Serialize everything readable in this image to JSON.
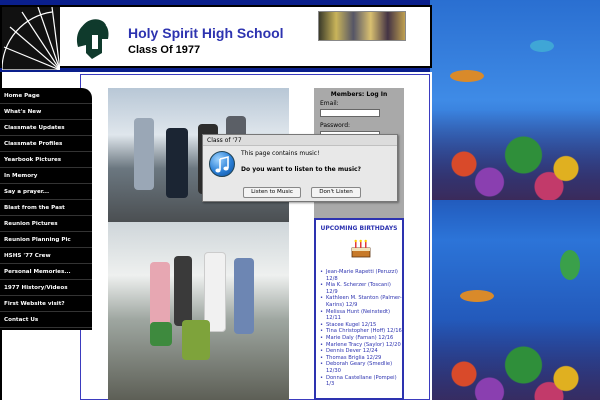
{
  "header": {
    "school_name": "Holy Spirit High School",
    "class_of": "Class Of 1977"
  },
  "nav": {
    "items": [
      "Home Page",
      "What's New",
      "Classmate Updates",
      "Classmate Profiles",
      "Yearbook Pictures",
      "In Memory",
      "Say a prayer...",
      "Blast from the Past",
      "Reunion Pictures",
      "Reunion Planning Pic",
      "HSHS '77 Crew",
      "Personal Memories...",
      "1977 History/Videos",
      "First Website visit?",
      "Contact Us"
    ]
  },
  "login": {
    "title": "Members: Log In",
    "email_label": "Email:",
    "password_label": "Password:"
  },
  "birthdays": {
    "title": "UPCOMING BIRTHDAYS",
    "entries": [
      "Jean-Marie Rapetti (Peruzzi)  12/8",
      "Mia K. Scherzer (Toscani)  12/9",
      "Kathleen M. Stanton (Palmer-Karins)  12/9",
      "Melissa Hunt (Neinstedt)  12/11",
      "Stacee Kugel  12/15",
      "Tina Christopher (Hoff)  12/16",
      "Marie Daly (Faman)  12/16",
      "Marlene Tracy (Saylor)  12/20",
      "Dennis Dever  12/24",
      "Thomas Briglia  12/29",
      "Deborah Geary (Smedlie)  12/30",
      "Donna Castellane (Pompei)  1/3"
    ]
  },
  "dialog": {
    "title": "Class of '77",
    "message": "This page contains music!",
    "question": "Do you want to listen to the music?",
    "listen_button": "Listen to Music",
    "decline_button": "Don't Listen"
  },
  "colors": {
    "brand_blue": "#2d33b0",
    "nav_bg": "#000000"
  }
}
